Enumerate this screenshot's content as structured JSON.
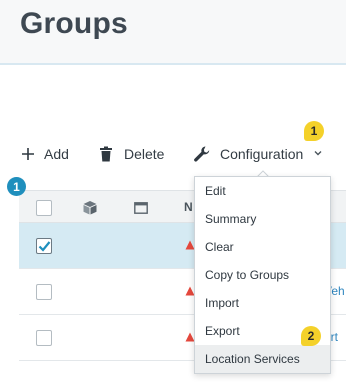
{
  "header": {
    "title": "Groups"
  },
  "toolbar": {
    "add_label": "Add",
    "delete_label": "Delete",
    "configuration_label": "Configuration"
  },
  "badges": {
    "top": "1",
    "table": "1",
    "menu": "2"
  },
  "table": {
    "header_partial": "N",
    "rows": [
      {
        "checked": true,
        "text": ""
      },
      {
        "checked": false,
        "text": "Veh"
      },
      {
        "checked": false,
        "text": "ert"
      }
    ]
  },
  "dropdown": {
    "items": [
      "Edit",
      "Summary",
      "Clear",
      "Copy to Groups",
      "Import",
      "Export",
      "Location Services"
    ],
    "active_item": "Location Services"
  },
  "colors": {
    "badge_yellow": "#f4d12a",
    "badge_blue": "#1f8fbd",
    "selected_row": "#d5eaf3",
    "alert_red": "#e5483d",
    "link_blue": "#2f86bf"
  }
}
